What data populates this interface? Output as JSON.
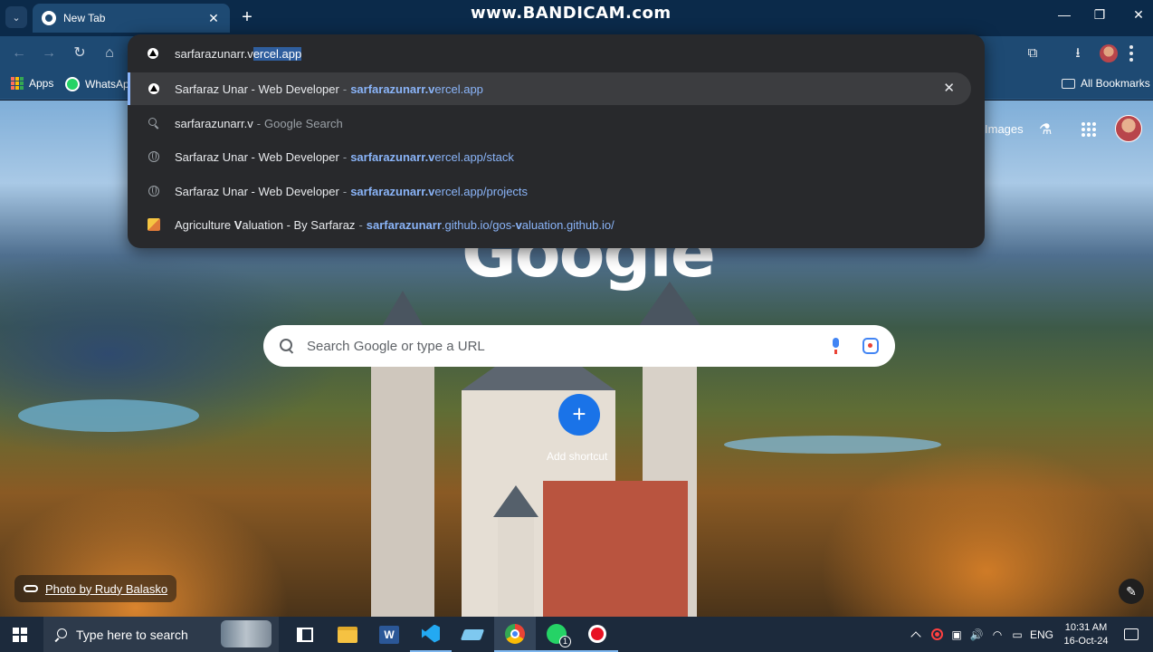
{
  "browser": {
    "tab": {
      "title": "New Tab"
    },
    "watermark": "www.BANDICAM.com",
    "omnibox": {
      "typed_text": "sarfarazunarr.v",
      "autocomplete_text": "ercel.app"
    },
    "bookmarks": [
      {
        "label": "Apps"
      },
      {
        "label": "WhatsApp"
      }
    ],
    "all_bookmarks_label": "All Bookmarks"
  },
  "suggestions": [
    {
      "title": "Sarfaraz Unar - Web Developer",
      "url_bold": "sarfarazunarr.v",
      "url_rest": "ercel.app",
      "icon": "site-favicon",
      "active": true
    },
    {
      "title": "sarfarazunarr.v",
      "suffix": "Google Search",
      "icon": "search-icon"
    },
    {
      "title": "Sarfaraz Unar - Web Developer",
      "url_bold": "sarfarazunarr.v",
      "url_rest": "ercel.app/stack",
      "icon": "globe-icon"
    },
    {
      "title": "Sarfaraz Unar - Web Developer",
      "url_bold": "sarfarazunarr.v",
      "url_rest": "ercel.app/projects",
      "icon": "globe-icon"
    },
    {
      "title_pre": "Agriculture ",
      "title_bold": "V",
      "title_post": "aluation - By Sarfaraz",
      "url_bold": "sarfarazunarr",
      "url_mid": ".github.io/gos-",
      "url_bold2": "v",
      "url_rest": "aluation.github.io/",
      "icon": "agri-favicon"
    }
  ],
  "ntp": {
    "images_link": "Images",
    "logo_text": "Google",
    "search_placeholder": "Search Google or type a URL",
    "add_shortcut_label": "Add shortcut",
    "photo_credit": "Photo by Rudy Balasko"
  },
  "taskbar": {
    "search_placeholder": "Type here to search",
    "whatsapp_badge": "1",
    "language": "ENG",
    "time": "10:31 AM",
    "date": "16-Oct-24"
  }
}
